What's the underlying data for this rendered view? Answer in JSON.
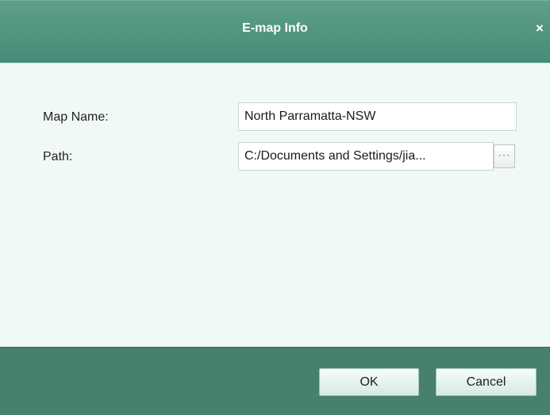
{
  "window": {
    "title": "E-map Info",
    "close_glyph": "×"
  },
  "form": {
    "map_name_label": "Map Name:",
    "map_name_value": "North Parramatta-NSW",
    "path_label": "Path:",
    "path_value": "C:/Documents and Settings/jia...",
    "browse_label": "···"
  },
  "buttons": {
    "ok_label": "OK",
    "cancel_label": "Cancel"
  },
  "colors": {
    "titlebar": "#5a9a85",
    "footer": "#48806e",
    "content_bg": "#f1f9f6"
  }
}
